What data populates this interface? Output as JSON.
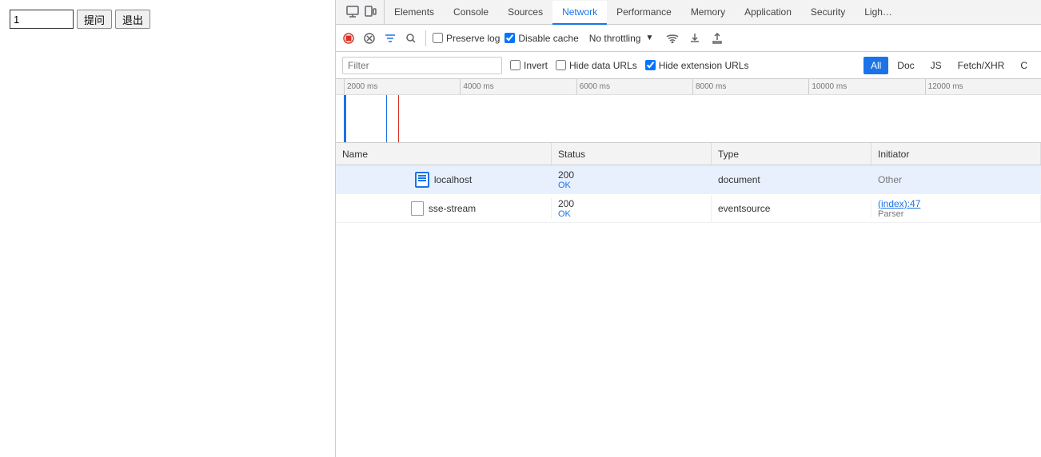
{
  "left_panel": {
    "input_placeholder": "1",
    "input_value": "1",
    "ask_button": "提问",
    "exit_button": "退出"
  },
  "devtools": {
    "tabs": [
      {
        "id": "elements",
        "label": "Elements",
        "active": false
      },
      {
        "id": "console",
        "label": "Console",
        "active": false
      },
      {
        "id": "sources",
        "label": "Sources",
        "active": false
      },
      {
        "id": "network",
        "label": "Network",
        "active": true
      },
      {
        "id": "performance",
        "label": "Performance",
        "active": false
      },
      {
        "id": "memory",
        "label": "Memory",
        "active": false
      },
      {
        "id": "application",
        "label": "Application",
        "active": false
      },
      {
        "id": "security",
        "label": "Security",
        "active": false
      },
      {
        "id": "lighthouse",
        "label": "Ligh…",
        "active": false
      }
    ],
    "toolbar": {
      "preserve_log_label": "Preserve log",
      "disable_cache_label": "Disable cache",
      "throttle_label": "No throttling"
    },
    "filter_bar": {
      "filter_placeholder": "Filter",
      "invert_label": "Invert",
      "hide_data_urls_label": "Hide data URLs",
      "hide_extension_urls_label": "Hide extension URLs",
      "type_buttons": [
        {
          "id": "all",
          "label": "All",
          "active": true
        },
        {
          "id": "doc",
          "label": "Doc",
          "active": false
        },
        {
          "id": "js",
          "label": "JS",
          "active": false
        },
        {
          "id": "fetch_xhr",
          "label": "Fetch/XHR",
          "active": false
        },
        {
          "id": "c",
          "label": "C",
          "active": false
        }
      ]
    },
    "timeline": {
      "ticks": [
        "2000 ms",
        "4000 ms",
        "6000 ms",
        "8000 ms",
        "10000 ms",
        "12000 ms"
      ]
    },
    "table": {
      "headers": [
        "Name",
        "Status",
        "Type",
        "Initiator"
      ],
      "rows": [
        {
          "name": "localhost",
          "icon": "doc",
          "status_code": "200",
          "status_text": "OK",
          "type": "document",
          "initiator": "Other",
          "initiator_link": false,
          "selected": true
        },
        {
          "name": "sse-stream",
          "icon": "generic",
          "status_code": "200",
          "status_text": "OK",
          "type": "eventsource",
          "initiator": "(index):47",
          "initiator_sub": "Parser",
          "initiator_link": true,
          "selected": false
        }
      ]
    }
  }
}
